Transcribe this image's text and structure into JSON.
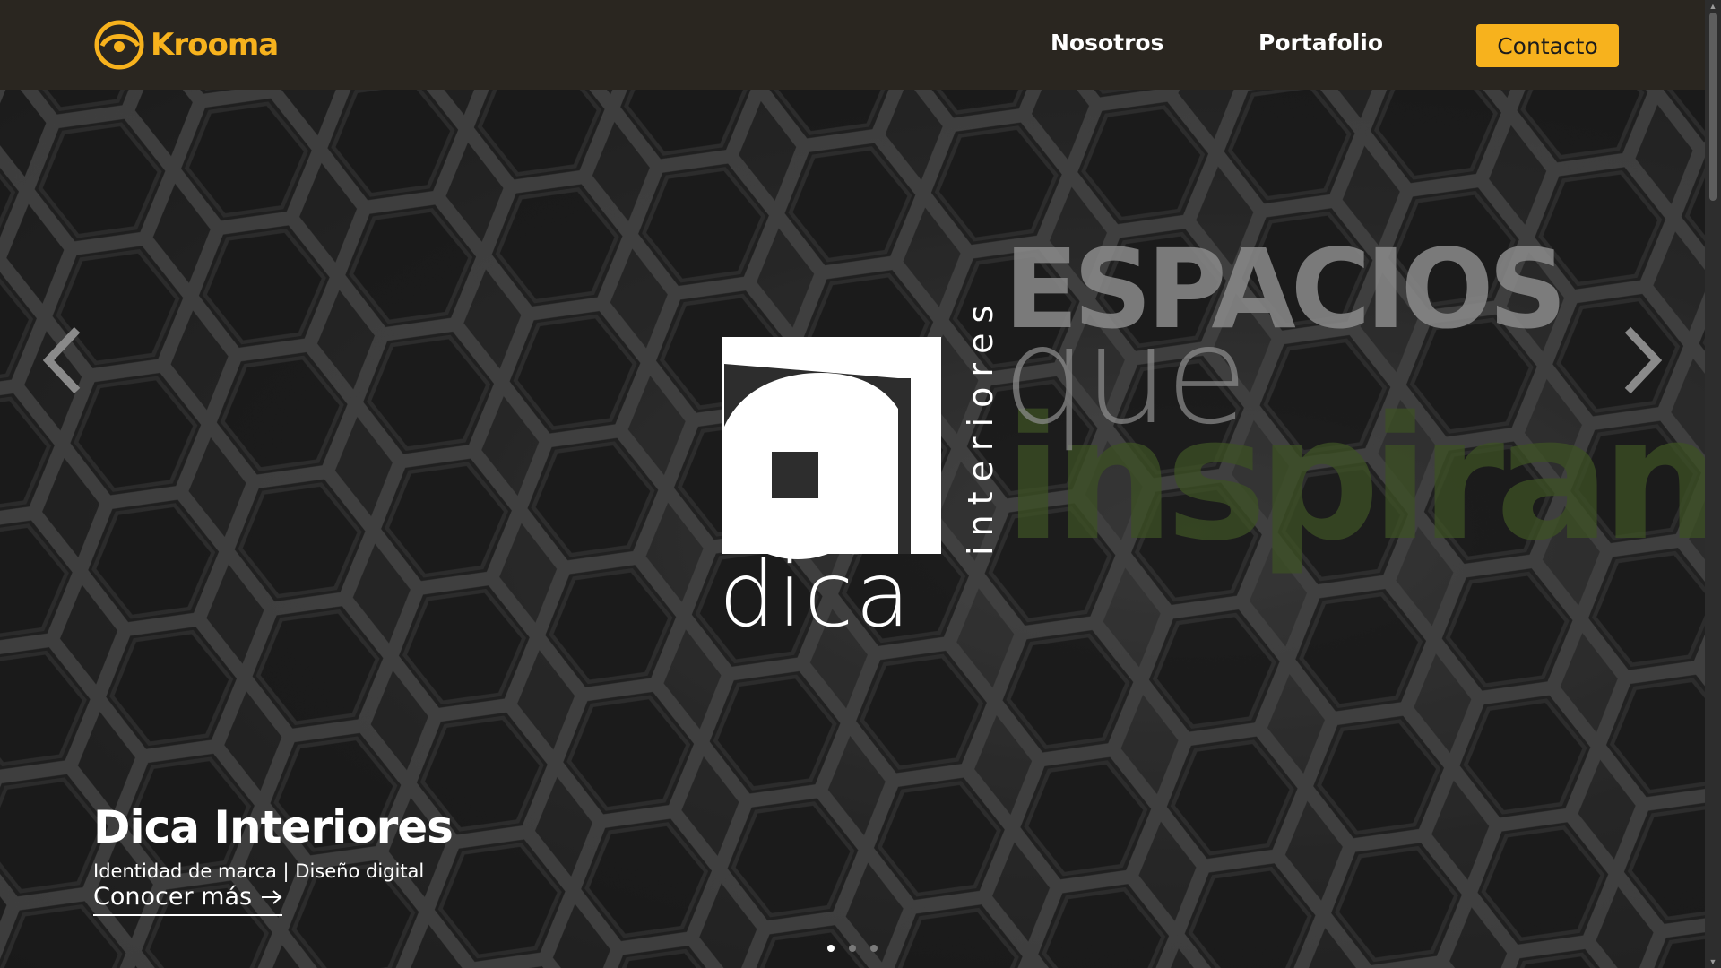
{
  "header": {
    "brand": "Krooma",
    "nav": [
      {
        "label": "Nosotros"
      },
      {
        "label": "Portafolio"
      }
    ],
    "contact_label": "Contacto"
  },
  "slide": {
    "logo_word": "dica",
    "logo_vertical": "interiores",
    "slogan": [
      "ESPACIOS",
      "que",
      "inspiran"
    ],
    "title": "Dica Interiores",
    "subtitle": "Identidad de marca | Diseño digital",
    "cta": "Conocer más"
  },
  "carousel": {
    "total_slides": 3,
    "active_index": 0
  },
  "colors": {
    "accent": "#f7b21d",
    "header_bg": "#2a2620",
    "slogan_green": "#3d5124"
  },
  "icons": [
    "krooma-logo-icon",
    "chevron-left-icon",
    "chevron-right-icon",
    "arrow-right-icon"
  ]
}
